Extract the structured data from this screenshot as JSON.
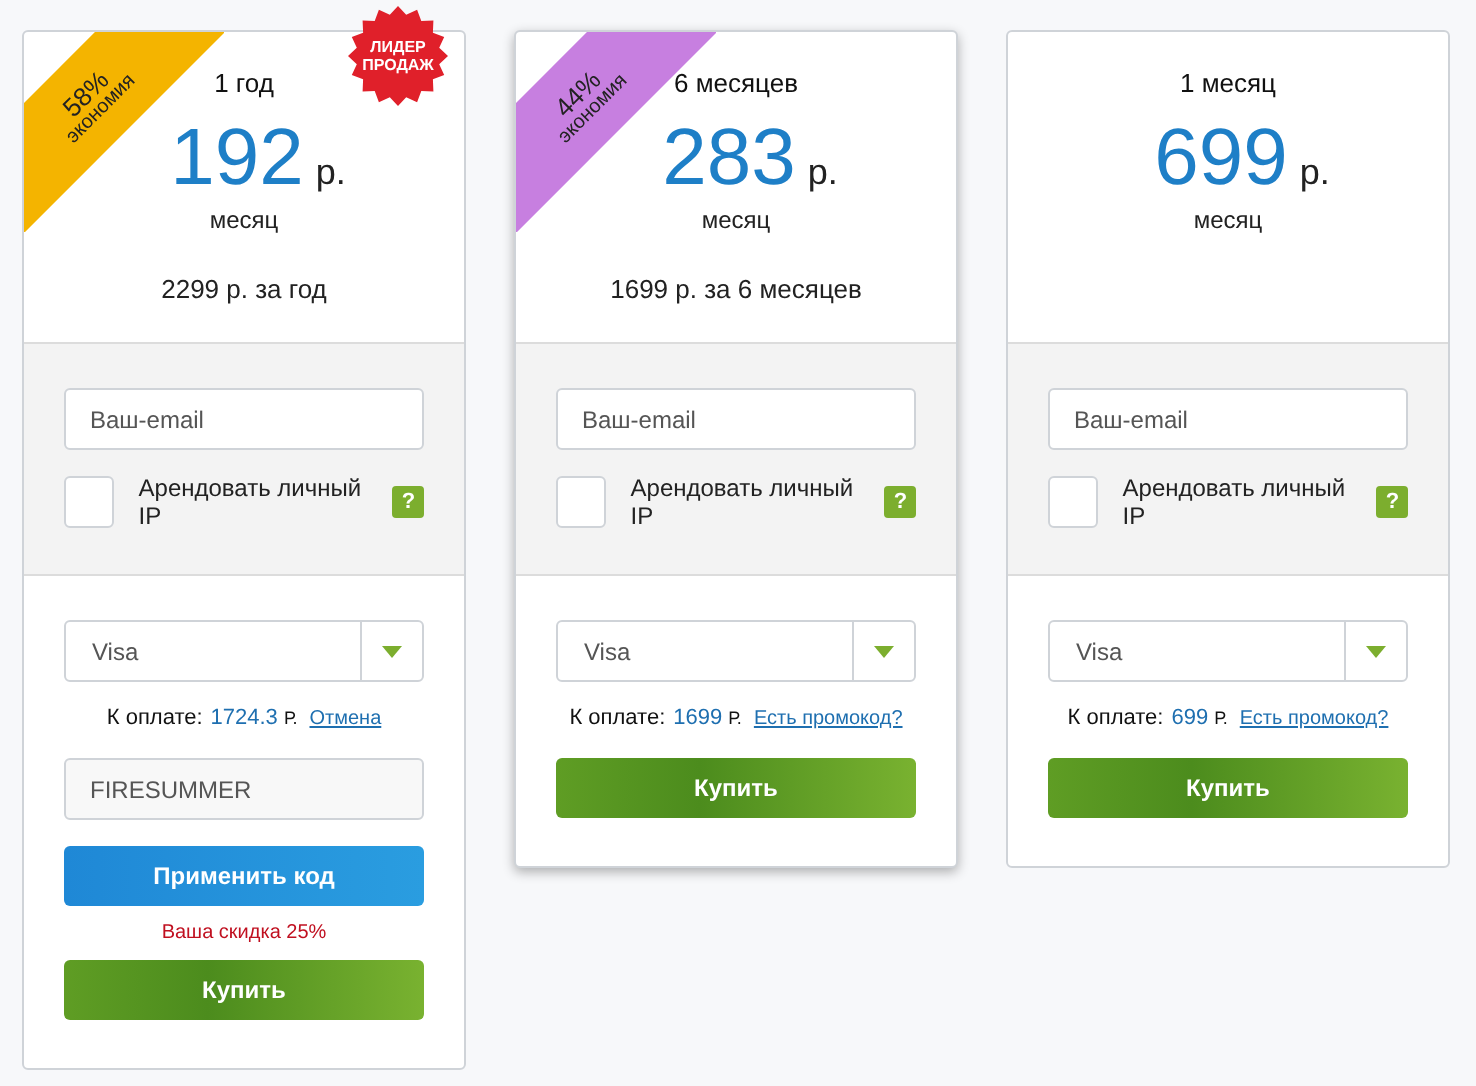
{
  "plans": [
    {
      "title": "1 год",
      "highlighted": false,
      "ribbon": {
        "percent": "58%",
        "label": "экономия",
        "color": "#f4b400"
      },
      "badge": "ЛИДЕР ПРОДАЖ",
      "price": "192",
      "currency": "р.",
      "per": "месяц",
      "total": "2299 р. за год",
      "email_placeholder": "Ваш-email",
      "ip_label": "Арендовать личный IP",
      "ip_checked": false,
      "help": "?",
      "payment": "Visa",
      "pay_label": "К оплате:",
      "amount": "1724.3",
      "amount_currency": "Р.",
      "link": "Отмена",
      "promo": {
        "value": "FIRESUMMER",
        "apply": "Применить код",
        "discount": "Ваша скидка 25%"
      },
      "buy": "Купить"
    },
    {
      "title": "6 месяцев",
      "highlighted": true,
      "ribbon": {
        "percent": "44%",
        "label": "экономия",
        "color": "#c77fe0"
      },
      "price": "283",
      "currency": "р.",
      "per": "месяц",
      "total": "1699 р. за 6 месяцев",
      "email_placeholder": "Ваш-email",
      "ip_label": "Арендовать личный IP",
      "ip_checked": false,
      "help": "?",
      "payment": "Visa",
      "pay_label": "К оплате:",
      "amount": "1699",
      "amount_currency": "Р.",
      "link": "Есть промокод?",
      "buy": "Купить"
    },
    {
      "title": "1 месяц",
      "highlighted": false,
      "price": "699",
      "currency": "р.",
      "per": "месяц",
      "email_placeholder": "Ваш-email",
      "ip_label": "Арендовать личный IP",
      "ip_checked": false,
      "help": "?",
      "payment": "Visa",
      "pay_label": "К оплате:",
      "amount": "699",
      "amount_currency": "Р.",
      "link": "Есть промокод?",
      "buy": "Купить"
    }
  ]
}
